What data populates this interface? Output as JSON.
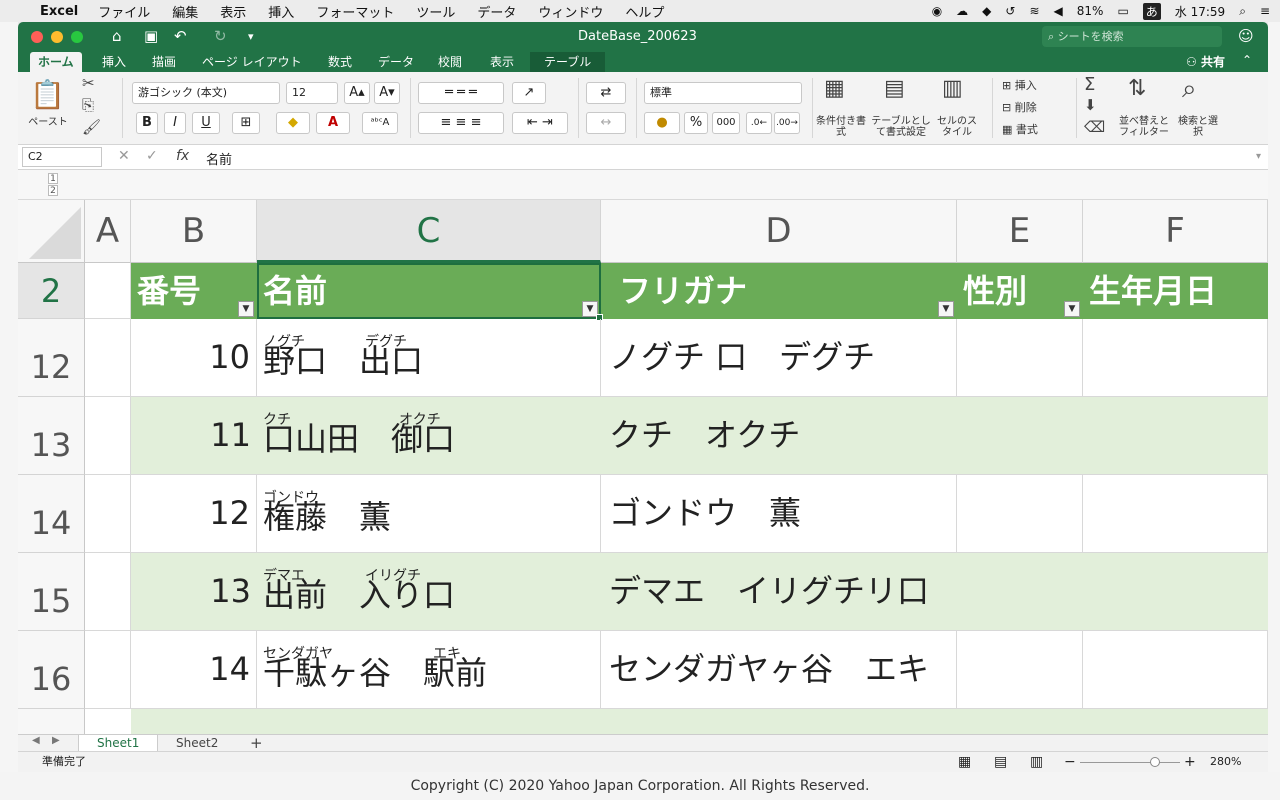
{
  "menubar": {
    "app_name": "Excel",
    "items": [
      "ファイル",
      "編集",
      "表示",
      "挿入",
      "フォーマット",
      "ツール",
      "データ",
      "ウィンドウ",
      "ヘルプ"
    ],
    "battery": "81%",
    "input_mode": "あ",
    "clock": "水 17:59"
  },
  "window": {
    "title": "DateBase_200623",
    "search_placeholder": "シートを検索",
    "share_label": "共有"
  },
  "ribbon_tabs": [
    "ホーム",
    "挿入",
    "描画",
    "ページ レイアウト",
    "数式",
    "データ",
    "校閲",
    "表示",
    "テーブル"
  ],
  "ribbon": {
    "paste_label": "ペースト",
    "font_name": "游ゴシック (本文)",
    "font_size": "12",
    "number_format": "標準",
    "percent": "%",
    "comma": "000",
    "bold": "B",
    "italic": "I",
    "underline": "U",
    "cond_format_label": "条件付き書式",
    "table_format_label": "テーブルとして書式設定",
    "cell_style_label": "セルのスタイル",
    "insert_label": "挿入",
    "delete_label": "削除",
    "format_label": "書式",
    "sort_filter_label": "並べ替えとフィルター",
    "find_select_label": "検索と選択"
  },
  "formula_bar": {
    "name_box": "C2",
    "fx": "fx",
    "content": "名前"
  },
  "outline_levels": [
    "1",
    "2"
  ],
  "grid": {
    "columns": [
      "A",
      "B",
      "C",
      "D",
      "E",
      "F"
    ],
    "selected_column": "C",
    "header_row": {
      "row": "2",
      "cells": [
        "番号",
        "名前",
        "フリガナ",
        "性別",
        "生年月日"
      ]
    },
    "rows": [
      {
        "row": "12",
        "num": "10",
        "name": "野口　出口",
        "ruby_a": "ノグチ",
        "ruby_b": "デグチ",
        "kana": "ノグチ 口　デグチ"
      },
      {
        "row": "13",
        "num": "11",
        "name": "口山田　御口",
        "ruby_a": "クチ",
        "ruby_b": "オクチ",
        "kana": "クチ　オクチ"
      },
      {
        "row": "14",
        "num": "12",
        "name": "権藤　薫",
        "ruby_a": "ゴンドウ",
        "ruby_b": "",
        "kana": "ゴンドウ　薫"
      },
      {
        "row": "15",
        "num": "13",
        "name": "出前　入り口",
        "ruby_a": "デマエ",
        "ruby_b": "イリグチ",
        "kana": "デマエ　イリグチリ口"
      },
      {
        "row": "16",
        "num": "14",
        "name": "千駄ヶ谷　駅前",
        "ruby_a": "センダガヤ",
        "ruby_b": "エキ",
        "kana": "センダガヤヶ谷　エキ"
      }
    ]
  },
  "sheets": [
    "Sheet1",
    "Sheet2"
  ],
  "active_sheet": "Sheet1",
  "status": {
    "ready": "準備完了",
    "zoom": "280%"
  },
  "footer": "Copyright (C) 2020 Yahoo Japan Corporation. All Rights Reserved.",
  "colors": {
    "excel_green": "#217346",
    "table_header": "#6aac57",
    "band": "#e2efda"
  }
}
